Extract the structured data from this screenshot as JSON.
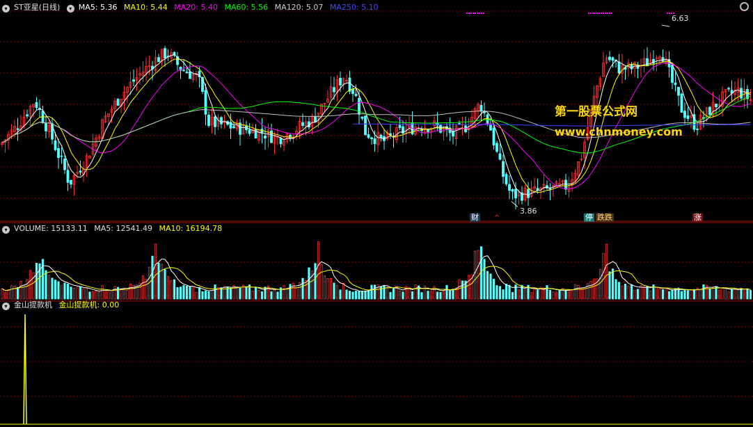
{
  "main_legend": {
    "title": "ST亚星(日线)",
    "ma5": "MA5: 5.36",
    "ma10": "MA10: 5.44",
    "ma20": "MA20: 5.40",
    "ma60": "MA60: 5.56",
    "ma120": "MA120: 5.07",
    "ma250": "MA250: 5.10"
  },
  "volume_legend": {
    "volume": "VOLUME: 15133.11",
    "ma5": "MA5: 12541.49",
    "ma10": "MA10: 16194.78"
  },
  "indicator_legend": {
    "name": "金山提款机",
    "value": "金山提款机: 0.00"
  },
  "annotations": {
    "high": "6.63",
    "low": "3.86",
    "tag_cai": "财",
    "tag_arrow": "^",
    "tag_ting": "停",
    "tag_diedie": "跌跌",
    "tag_zhang": "涨"
  },
  "watermark": {
    "line1": "第一股票公式网",
    "line2": "www.chnmoney.com"
  },
  "colors": {
    "up": "#ff3232",
    "down": "#54ffff",
    "ma5": "#ffffff",
    "ma10": "#ffff00",
    "ma20": "#ff00ff",
    "ma60": "#00ff00",
    "ma120": "#c0c0c0",
    "ma250": "#4040ff",
    "grid": "#8b0000",
    "indicator": "#ffff00"
  },
  "chart_data": [
    {
      "type": "candlestick",
      "title": "ST亚星(日线)",
      "ylim": [
        3.55,
        6.85
      ],
      "price_path": [
        [
          0,
          4.75
        ],
        [
          25,
          5.05
        ],
        [
          50,
          5.45
        ],
        [
          75,
          4.85
        ],
        [
          100,
          4.15
        ],
        [
          125,
          4.55
        ],
        [
          150,
          5.15
        ],
        [
          175,
          5.55
        ],
        [
          200,
          5.85
        ],
        [
          225,
          6.1
        ],
        [
          240,
          6.2
        ],
        [
          260,
          5.95
        ],
        [
          285,
          5.8
        ],
        [
          300,
          5.1
        ],
        [
          325,
          5.05
        ],
        [
          350,
          5.0
        ],
        [
          375,
          4.95
        ],
        [
          400,
          4.85
        ],
        [
          425,
          5.0
        ],
        [
          450,
          5.15
        ],
        [
          475,
          5.55
        ],
        [
          495,
          5.85
        ],
        [
          510,
          5.55
        ],
        [
          525,
          4.95
        ],
        [
          550,
          4.8
        ],
        [
          575,
          4.95
        ],
        [
          600,
          5.05
        ],
        [
          625,
          5.05
        ],
        [
          650,
          4.9
        ],
        [
          670,
          5.05
        ],
        [
          690,
          5.4
        ],
        [
          705,
          5.0
        ],
        [
          720,
          4.35
        ],
        [
          735,
          3.95
        ],
        [
          760,
          4.0
        ],
        [
          790,
          4.05
        ],
        [
          815,
          4.1
        ],
        [
          835,
          4.55
        ],
        [
          855,
          5.55
        ],
        [
          870,
          6.15
        ],
        [
          890,
          5.95
        ],
        [
          910,
          5.95
        ],
        [
          930,
          6.05
        ],
        [
          950,
          6.25
        ],
        [
          965,
          5.75
        ],
        [
          980,
          5.3
        ],
        [
          1000,
          5.05
        ],
        [
          1020,
          5.3
        ],
        [
          1040,
          5.5
        ],
        [
          1060,
          5.6
        ],
        [
          1080,
          5.45
        ]
      ],
      "high_label": {
        "x": 951,
        "price": 6.63
      },
      "low_label": {
        "x": 735,
        "price": 3.86
      },
      "ma_lines": {
        "ma5": "5.36",
        "ma10": "5.44",
        "ma20": "5.40",
        "ma60": "5.56",
        "ma120": "5.07",
        "ma250": "5.10"
      }
    },
    {
      "type": "bar",
      "title": "VOLUME",
      "values_note": "volume bars",
      "last": {
        "volume": 15133.11,
        "ma5": 12541.49,
        "ma10": 16194.78
      },
      "spikes": [
        [
          55,
          0.75
        ],
        [
          225,
          0.75
        ],
        [
          455,
          0.8
        ],
        [
          688,
          0.85
        ],
        [
          870,
          0.65
        ]
      ]
    },
    {
      "type": "line",
      "title": "金山提款机",
      "last_value": 0.0,
      "spike_x": 36
    }
  ]
}
